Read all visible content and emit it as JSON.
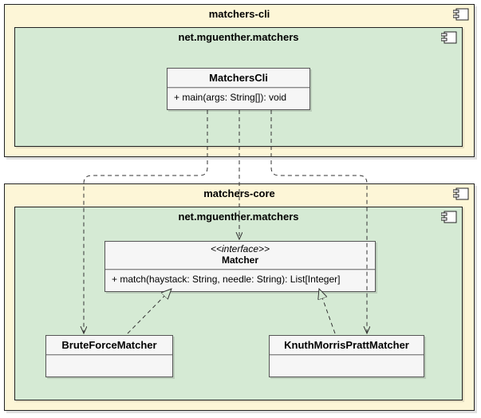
{
  "module_cli": {
    "title": "matchers-cli",
    "package": {
      "title": "net.mguenther.matchers",
      "class": {
        "name": "MatchersCli",
        "op": "+ main(args: String[]): void"
      }
    }
  },
  "module_core": {
    "title": "matchers-core",
    "package": {
      "title": "net.mguenther.matchers",
      "interface": {
        "stereo": "<<interface>>",
        "name": "Matcher",
        "op": "+ match(haystack: String, needle: String): List[Integer]"
      },
      "bfm": {
        "name": "BruteForceMatcher"
      },
      "kmp": {
        "name": "KnuthMorrisPrattMatcher"
      }
    }
  }
}
